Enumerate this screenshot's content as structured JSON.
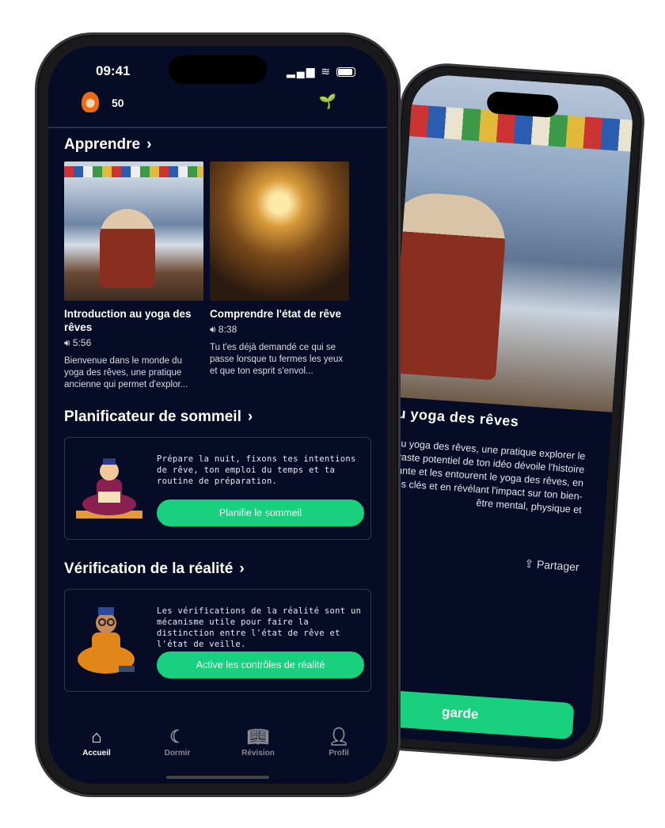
{
  "back_screen": {
    "title": "on au yoga des rêves",
    "description": "de du yoga des rêves, une pratique explorer le vaste potentiel de ton idéo dévoile l'histoire fascinante et les entourent le yoga des rêves, en losophies clés et en révélant l'impact sur ton bien-être mental, physique et",
    "share_label": "Partager",
    "button_label": "garde"
  },
  "status_bar": {
    "time": "09:41"
  },
  "header": {
    "points": "50",
    "avatar_icon": "flame-monk-avatar",
    "right_icon": "sprout-icon"
  },
  "learn": {
    "title": "Apprendre",
    "cards": [
      {
        "title": "Introduction au yoga des rêves",
        "duration": "5:56",
        "description": "Bienvenue dans le monde du yoga des rêves, une pratique ancienne qui permet d'explor..."
      },
      {
        "title": "Comprendre l'état de rêve",
        "duration": "8:38",
        "description": "Tu t'es déjà demandé ce qui se passe lorsque tu fermes les yeux et que ton esprit s'envol..."
      }
    ]
  },
  "sleep_planner": {
    "title": "Planificateur de sommeil",
    "text": "Prépare la nuit, fixons tes intentions de rêve, ton emploi du temps et ta routine de préparation.",
    "button_label": "Planifie le sommeil"
  },
  "reality_check": {
    "title": "Vérification de la réalité",
    "text": "Les vérifications de la réalité sont un mécanisme utile pour faire la distinction entre l'état de rêve et l'état de veille.",
    "button_label": "Active les contrôles de réalité"
  },
  "nav": [
    {
      "label": "Accueil",
      "icon": "home-icon",
      "active": true
    },
    {
      "label": "Dormir",
      "icon": "moon-icon"
    },
    {
      "label": "Révision",
      "icon": "book-icon"
    },
    {
      "label": "Profil",
      "icon": "person-icon"
    }
  ],
  "colors": {
    "background": "#060b26",
    "accent": "#19d07f"
  }
}
